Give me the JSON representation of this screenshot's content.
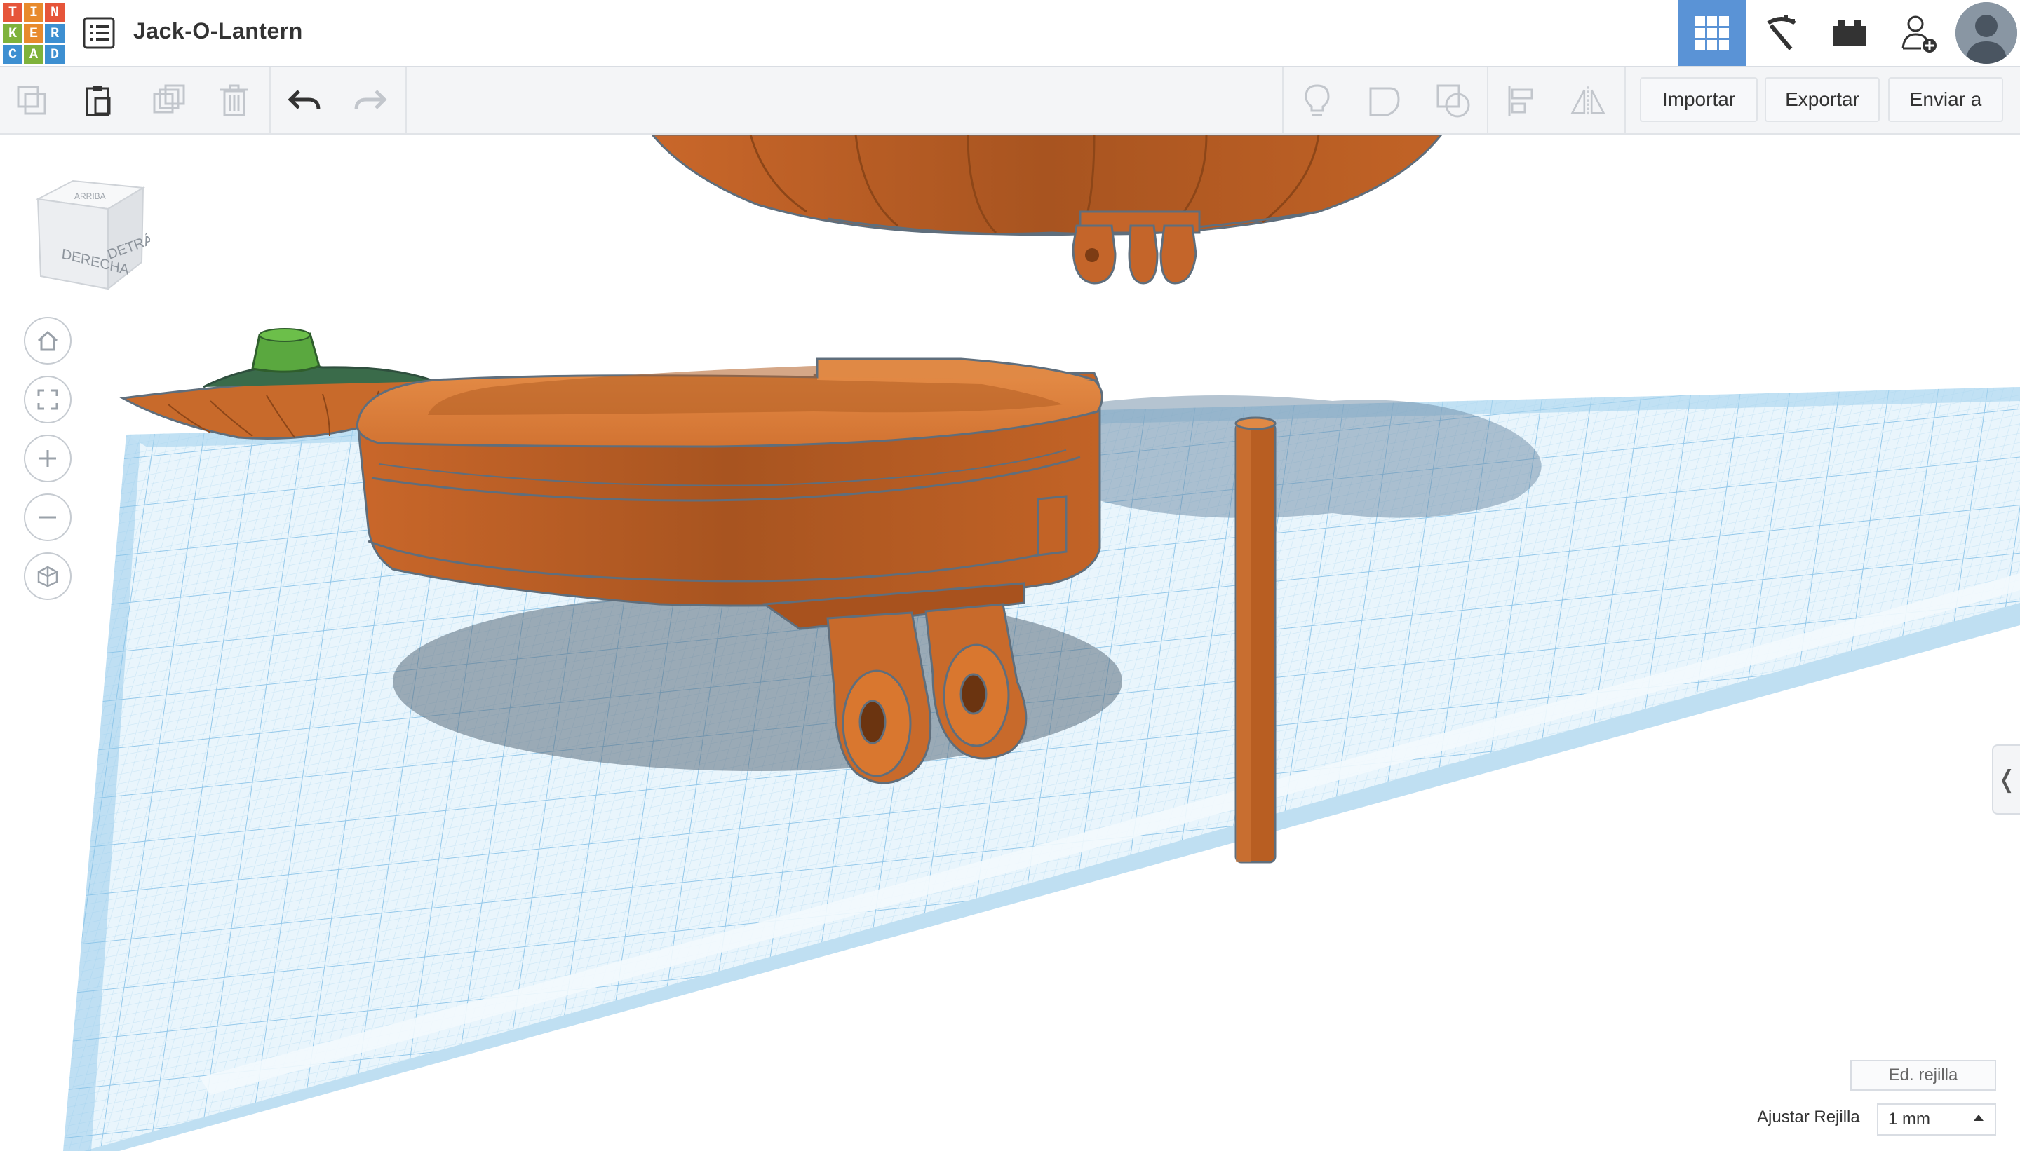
{
  "app": {
    "logo_letters": [
      "T",
      "I",
      "N",
      "K",
      "E",
      "R",
      "C",
      "A",
      "D"
    ],
    "logo_colors": [
      "#e6553a",
      "#e88a2c",
      "#e6553a",
      "#7fb23b",
      "#e88a2c",
      "#3d8fd1",
      "#3d8fd1",
      "#7fb23b",
      "#3d8fd1"
    ],
    "design_title": "Jack-O-Lantern"
  },
  "header_icons": [
    "3d-design-icon",
    "pickaxe-icon",
    "bricks-icon",
    "add-user-icon",
    "avatar"
  ],
  "toolbar": {
    "left_icons": [
      "copy-icon",
      "paste-icon",
      "duplicate-icon",
      "delete-icon",
      "undo-icon",
      "redo-icon"
    ],
    "right_icons": [
      "lightbulb-icon",
      "shape-note-icon",
      "shape-group-icon",
      "align-icon",
      "mirror-icon"
    ],
    "import_label": "Importar",
    "export_label": "Exportar",
    "send_label": "Enviar a"
  },
  "viewcube": {
    "face_right": "DERECHA",
    "face_back": "DETRÁS",
    "face_top": "ARRIBA"
  },
  "nav_controls": [
    "home-view",
    "fit-view",
    "zoom-in",
    "zoom-out",
    "perspective-toggle"
  ],
  "grid": {
    "edit_label": "Ed. rejilla",
    "snap_label": "Ajustar Rejilla",
    "snap_value": "1 mm"
  },
  "colors": {
    "accent": "#5a93d6",
    "pumpkin": "#d9772f",
    "pumpkin_dark": "#a9521c",
    "stem_green": "#4e9a3a",
    "grid_blue": "#9fd0ee"
  }
}
